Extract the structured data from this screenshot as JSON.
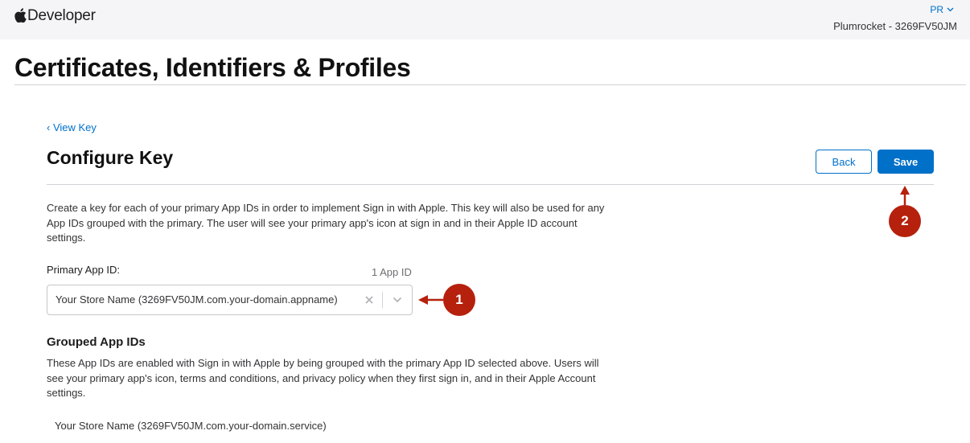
{
  "header": {
    "brand": "Developer",
    "account_initials": "PR",
    "team_name": "Plumrocket - 3269FV50JM"
  },
  "page_title": "Certificates, Identifiers & Profiles",
  "nav": {
    "back_link": "‹ View Key"
  },
  "section": {
    "title": "Configure Key",
    "back_button": "Back",
    "save_button": "Save"
  },
  "description": "Create a key for each of your primary App IDs in order to implement Sign in with Apple. This key will also be used for any App IDs grouped with the primary. The user will see your primary app's icon at sign in and in their Apple ID account settings.",
  "primary_app_id": {
    "label": "Primary App ID:",
    "count": "1 App ID",
    "selected_value": "Your Store Name (3269FV50JM.com.your-domain.appname)"
  },
  "grouped_app_ids": {
    "heading": "Grouped App IDs",
    "description": "These App IDs are enabled with Sign in with Apple by being grouped with the primary App ID selected above. Users will see your primary app's icon, terms and conditions, and privacy policy when they first sign in, and in their Apple Account settings.",
    "items": [
      "Your Store Name (3269FV50JM.com.your-domain.service)"
    ]
  },
  "annotations": [
    {
      "number": "1"
    },
    {
      "number": "2"
    }
  ],
  "colors": {
    "accent": "#0070c9",
    "marker": "#b5210d",
    "header_bg": "#f5f5f7"
  },
  "icons": [
    "apple-logo-icon",
    "chevron-down-icon",
    "clear-icon",
    "dropdown-chevron-icon",
    "arrow-icon"
  ]
}
